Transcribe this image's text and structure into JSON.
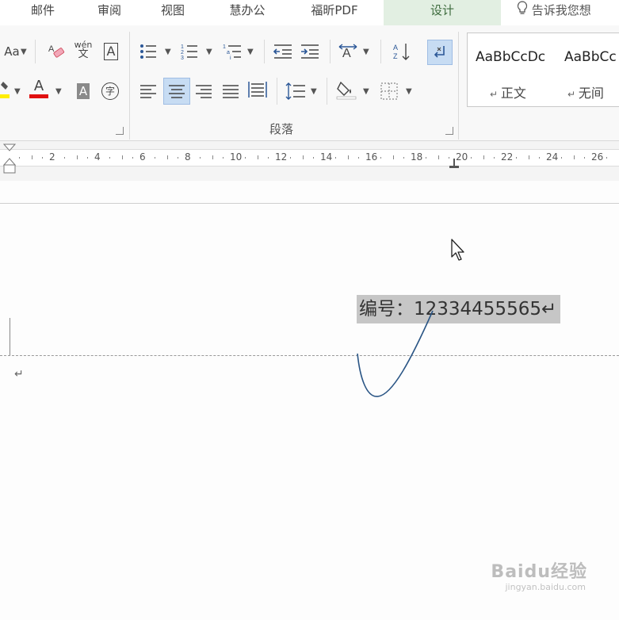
{
  "tabs": [
    {
      "label": "邮件",
      "active": false
    },
    {
      "label": "审阅",
      "active": false
    },
    {
      "label": "视图",
      "active": false
    },
    {
      "label": "慧办公",
      "active": false
    },
    {
      "label": "福昕PDF",
      "active": false
    },
    {
      "label": "设计",
      "active": true
    }
  ],
  "tell_me": "告诉我您想",
  "ribbon": {
    "font_case_label": "Aa",
    "phonetic_top": "wén",
    "phonetic_bottom": "文",
    "border_char": "A",
    "font_color_char": "A",
    "shading_char": "A",
    "enclose_char": "字",
    "paragraph_group_label": "段落",
    "styles": [
      {
        "sample": "AaBbCcDc",
        "name": "正文"
      },
      {
        "sample": "AaBbCc",
        "name": "无间"
      }
    ]
  },
  "ruler": {
    "labels": [
      "2",
      "4",
      "6",
      "8",
      "10",
      "12",
      "14",
      "16",
      "18",
      "20",
      "22",
      "24",
      "26"
    ]
  },
  "document": {
    "selected_text": "编号：12334455565↵",
    "paragraph_mark": "↵"
  },
  "watermark": {
    "text": "Baidu经验",
    "sub": "jingyan.baidu.com"
  },
  "colors": {
    "active_tab_bg": "#e2efe2",
    "selection_bg": "#c6c6c6",
    "highlight_button": "#c7dcf3",
    "font_color_bar": "#e01010",
    "highlighter_bar": "#ffee00",
    "annotation_stroke": "#2a5585"
  }
}
